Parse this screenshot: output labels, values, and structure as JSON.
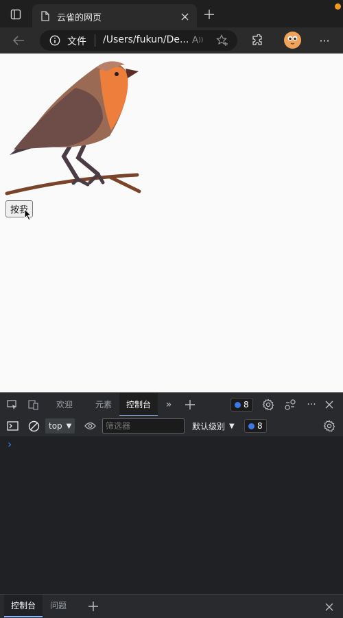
{
  "browser": {
    "tab_title": "云雀的网页",
    "address_info": "文件",
    "address_url": "/Users/fukun/De..."
  },
  "page": {
    "button_label": "按我"
  },
  "devtools": {
    "tabs": [
      "欢迎",
      "元素",
      "控制台"
    ],
    "issues_count": "8",
    "context": "top",
    "filter_placeholder": "筛选器",
    "level": "默认级别",
    "messages_count": "8",
    "prompt": "›",
    "drawer_tabs": [
      "控制台",
      "问题"
    ]
  },
  "colors": {
    "accent": "#8ab4f8",
    "bird_orange": "#ee7e3b",
    "bird_brown": "#8c5a4c",
    "branch": "#7a4428"
  }
}
